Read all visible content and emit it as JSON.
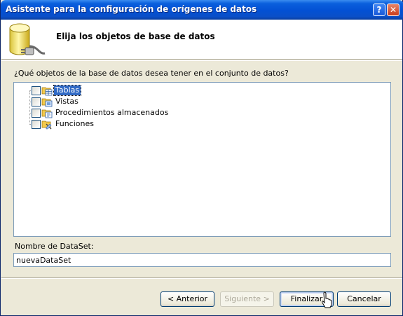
{
  "window": {
    "title": "Asistente para la configuración de orígenes de datos",
    "help_label": "?",
    "close_label": "✕"
  },
  "header": {
    "title": "Elija los objetos de base de datos",
    "icon": "database-plug-icon"
  },
  "main": {
    "question": "¿Qué objetos de la base de datos desea tener en el conjunto de datos?",
    "tree": [
      {
        "label": "Tablas",
        "checked": false,
        "selected": true,
        "icon": "tables-folder-icon"
      },
      {
        "label": "Vistas",
        "checked": false,
        "selected": false,
        "icon": "views-folder-icon"
      },
      {
        "label": "Procedimientos almacenados",
        "checked": false,
        "selected": false,
        "icon": "stored-procedures-folder-icon"
      },
      {
        "label": "Funciones",
        "checked": false,
        "selected": false,
        "icon": "functions-folder-icon"
      }
    ],
    "dataset_label": "Nombre de DataSet:",
    "dataset_value": "nuevaDataSet"
  },
  "footer": {
    "back_label": "< Anterior",
    "next_label": "Siguiente >",
    "finish_label": "Finalizar",
    "cancel_label": "Cancelar"
  },
  "colors": {
    "titlebar": "#0350d3",
    "selection": "#316ac5",
    "face": "#ece9d8"
  }
}
